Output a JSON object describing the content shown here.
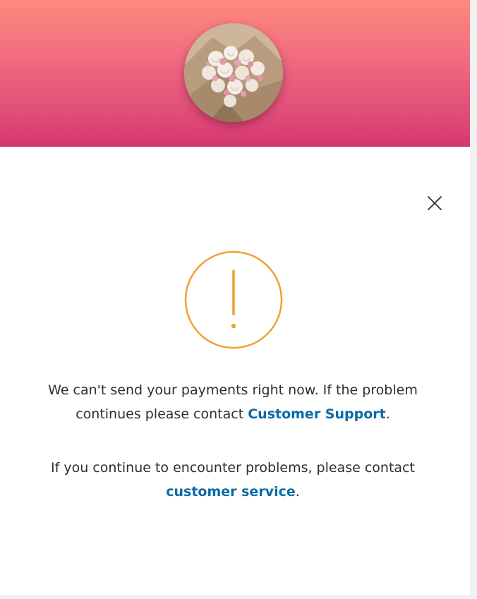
{
  "messages": {
    "primary": {
      "text_before": "We can't send your payments right now. If the problem continues please contact",
      "link_label": "Customer Support",
      "text_after": "."
    },
    "secondary": {
      "text_before": "If you continue to encounter problems, please contact",
      "link_label": "customer service",
      "text_after": "."
    }
  },
  "icons": {
    "close": "close-icon",
    "warning": "exclamation-circle-icon",
    "avatar": "flower-bouquet-photo"
  },
  "colors": {
    "header_top": "#ff8a7e",
    "header_bottom": "#d5386f",
    "warning": "#f29f2e",
    "link": "#0a6aa8",
    "text": "#2c2e2f"
  }
}
